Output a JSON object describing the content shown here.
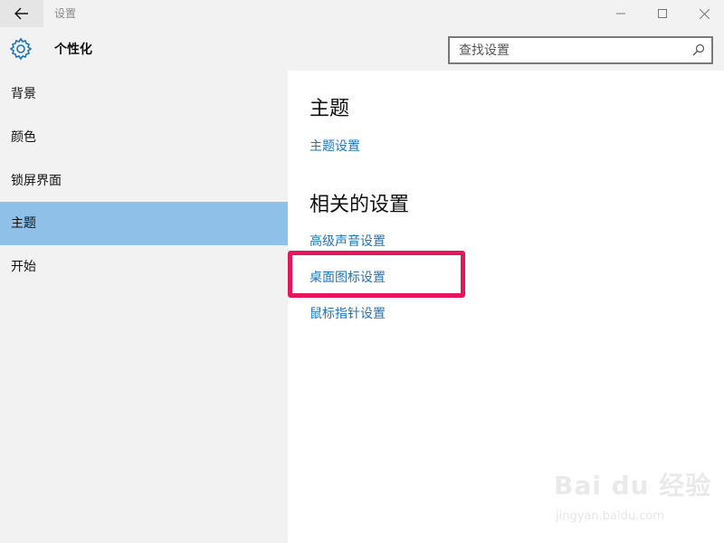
{
  "titlebar": {
    "title": "设置",
    "back_icon": "back-arrow-icon",
    "controls": [
      "minimize-icon",
      "maximize-icon",
      "close-icon"
    ]
  },
  "header": {
    "icon": "gear-icon",
    "title": "个性化",
    "search": {
      "placeholder": "查找设置",
      "value": "",
      "icon": "search-icon"
    }
  },
  "sidebar": {
    "items": [
      {
        "label": "背景",
        "selected": false
      },
      {
        "label": "颜色",
        "selected": false
      },
      {
        "label": "锁屏界面",
        "selected": false
      },
      {
        "label": "主题",
        "selected": true
      },
      {
        "label": "开始",
        "selected": false
      }
    ]
  },
  "main": {
    "sections": [
      {
        "title": "主题",
        "links": [
          "主题设置"
        ]
      },
      {
        "title": "相关的设置",
        "links": [
          "高级声音设置",
          "桌面图标设置",
          "鼠标指针设置"
        ]
      }
    ],
    "highlighted_link": "桌面图标设置"
  },
  "watermark": {
    "logo": "Bai du 经验",
    "url": "jingyan.baidu.com"
  },
  "colors": {
    "accent_link": "#1f73b7",
    "selected_nav": "#8fc0e8",
    "highlight_border": "#e5165d",
    "chrome_bg": "#f2f2f2"
  }
}
